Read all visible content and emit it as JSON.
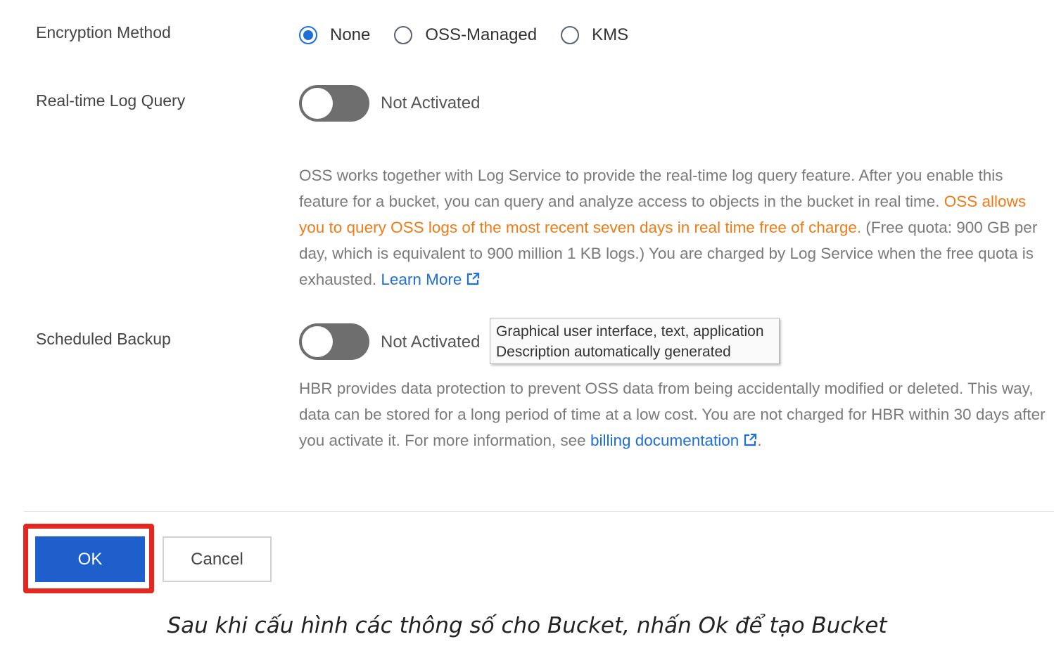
{
  "encryption": {
    "label": "Encryption Method",
    "options": [
      {
        "label": "None",
        "selected": true
      },
      {
        "label": "OSS-Managed",
        "selected": false
      },
      {
        "label": "KMS",
        "selected": false
      }
    ]
  },
  "log_query": {
    "label": "Real-time Log Query",
    "status": "Not Activated",
    "enabled": false,
    "desc_part1": "OSS works together with Log Service to provide the real-time log query feature. After you enable this feature for a bucket, you can query and analyze access to objects in the bucket in real time.",
    "desc_highlight": "OSS allows you to query OSS logs of the most recent seven days in real time free of charge.",
    "desc_part2": " (Free quota: 900 GB per day, which is equivalent to 900 million 1 KB logs.) You are charged by Log Service when the free quota is exhausted.",
    "link_label": "Learn More"
  },
  "backup": {
    "label": "Scheduled Backup",
    "status": "Not Activated",
    "enabled": false,
    "desc_part1": "HBR provides data protection to prevent OSS data from being accidentally modified or deleted. This way, data can be stored for a long period of time at a low cost. You are not charged for HBR within 30 days after you activate it. For more information, see",
    "link_label": "billing documentation",
    "desc_end": "."
  },
  "tooltip": {
    "line1": "Graphical user interface, text, application",
    "line2": "Description automatically generated"
  },
  "buttons": {
    "ok": "OK",
    "cancel": "Cancel"
  },
  "caption": "Sau khi cấu hình các thông số cho Bucket, nhấn Ok để tạo Bucket",
  "colors": {
    "accent": "#1e6fd9",
    "highlight_text": "#f07b16",
    "ok_button": "#1f5fcc",
    "annotation_box": "#e5271f"
  },
  "icons": [
    "external-link-icon"
  ]
}
